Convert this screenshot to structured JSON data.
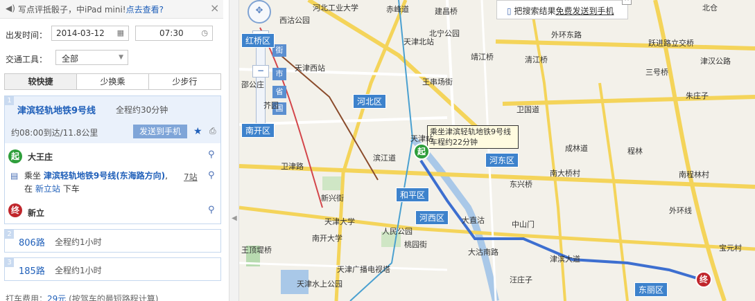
{
  "promo": {
    "text": "写点评抵骰子，中iPad mini!",
    "link": "点去查看?"
  },
  "form": {
    "depart_label": "出发时间：",
    "date": "2014-03-12",
    "time": "07:30",
    "transport_label": "交通工具：",
    "transport_value": "全部"
  },
  "tabs": [
    "较快捷",
    "少换乘",
    "少步行"
  ],
  "routes": {
    "r1": {
      "num": "1",
      "name": "津滨轻轨地铁9号线",
      "duration": "全程约30分钟",
      "sub": "约08:00到达/11.8公里",
      "send": "发送到手机",
      "start_badge": "起",
      "start": "大王庄",
      "step_prefix": "乘坐",
      "step_line": "津滨轻轨地铁9号线(东海路方向)",
      "step_mid": ", 在",
      "step_station": "新立站",
      "step_suffix": "下车",
      "step_count": "7站",
      "end_badge": "终",
      "end": "新立"
    },
    "r2": {
      "num": "2",
      "name": "806路",
      "duration": "全程约1小时"
    },
    "r3": {
      "num": "3",
      "name": "185路",
      "duration": "全程约1小时"
    }
  },
  "fare": {
    "label": "打车费用：",
    "value": "29元",
    "note": "(按驾车的最短路程计算)"
  },
  "map": {
    "infobox_text": "把搜索结果",
    "infobox_link": "免费发送到手机",
    "tip_line1": "乘坐津滨轻轨地铁9号线",
    "tip_line2": "车程约22分钟",
    "zoom_levels": [
      "街",
      "市",
      "省",
      "国"
    ],
    "start_marker": "起",
    "end_marker": "终",
    "districts": [
      "河北区",
      "河东区",
      "和平区",
      "河西区",
      "南开区",
      "东丽区",
      "红桥区"
    ],
    "labels": [
      "西沽公园",
      "河北工业大学",
      "建昌桥",
      "北宁公园",
      "天津北站",
      "靖江桥",
      "天津西站",
      "王串场街",
      "邵公庄",
      "芥园",
      "天津站",
      "滨江道",
      "新兴街",
      "天津大学",
      "南开大学",
      "人民公园",
      "桃园街",
      "天津广播电视塔",
      "天津水上公园",
      "王顶堤桥",
      "大直沽",
      "中山门",
      "东兴桥",
      "南大桥村",
      "程林",
      "成林道",
      "卫国道",
      "清江桥",
      "外环东路",
      "跃进路立交桥",
      "津汉公路",
      "三号桥",
      "朱庄子",
      "南程林村",
      "宝元村",
      "汪庄子",
      "赤峰道",
      "北仓",
      "外环线",
      "津滨大道",
      "卫津路",
      "大沽南路"
    ]
  },
  "colors": {
    "accent": "#1f5fb9",
    "route_line": "#3d6fd0",
    "start": "#2e9e3b",
    "end": "#c0262c"
  }
}
